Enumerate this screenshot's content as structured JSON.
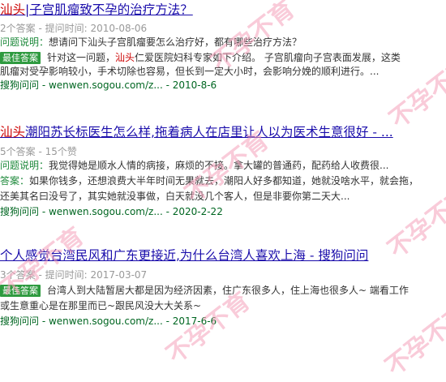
{
  "results": [
    {
      "title_hl": "汕头",
      "title_rest": "|子宫肌瘤致不孕的治疗方法？",
      "meta": "2个答案 - 提问时间: 2010-08-06",
      "q_label": "问题说明：",
      "q_text": "想请问下汕头子宫肌瘤要怎么治疗好，都有哪些治疗方法？",
      "badge": "最佳答案",
      "a_pre": "针对这一问题，",
      "a_hl": "汕头",
      "a_post": "仁爱医院妇科专家如下介绍。 子宫肌瘤向子宫表面发展，这类",
      "a_line2": "肌瘤对受孕影响较小，手术切除也容易，但长到一定大小时，会影响分娩的顺利进行。...",
      "url": "搜狗问问 - wenwen.sogou.com/z... - 2010-8-6"
    },
    {
      "title_hl": "汕头",
      "title_rest": "潮阳苏长标医生怎么样,拖着病人在店里让人以为医术生意很好 - ...",
      "meta": "5个答案 - 15个赞",
      "q_label": "问题说明：",
      "q_text": "我觉得她是顺水人情的病接，麻烦的不接。拿大罐的普通药，配药给人收费很...",
      "ans_label": "答案：",
      "ans_text": "如果你钱多，还想浪费大半年时间无果就去，潮阳人好多都知道，她就没啥水平，就会拖，",
      "ans_line2": "还美其名曰没号了，其实她就没事做，白天就没几个客人，但是非要你第二天大...",
      "url": "搜狗问问 - wenwen.sogou.com/z... - 2020-2-22"
    },
    {
      "title": "个人感觉台湾民风和广东更接近,为什么台湾人喜欢上海 - 搜狗问问",
      "meta": "3个答案 - 提问时间: 2017-03-07",
      "badge": "最佳答案",
      "a_text": "台湾人到大陆暂居大都是因为经济因素，住广东很多人，住上海也很多人~ 端看工作",
      "a_line2": "或生意重心是在那里而已~跟民风没大大关系~",
      "url": "搜狗问问 - wenwen.sogou.com/z... - 2017-6-6"
    }
  ],
  "watermark": "不孕不育"
}
